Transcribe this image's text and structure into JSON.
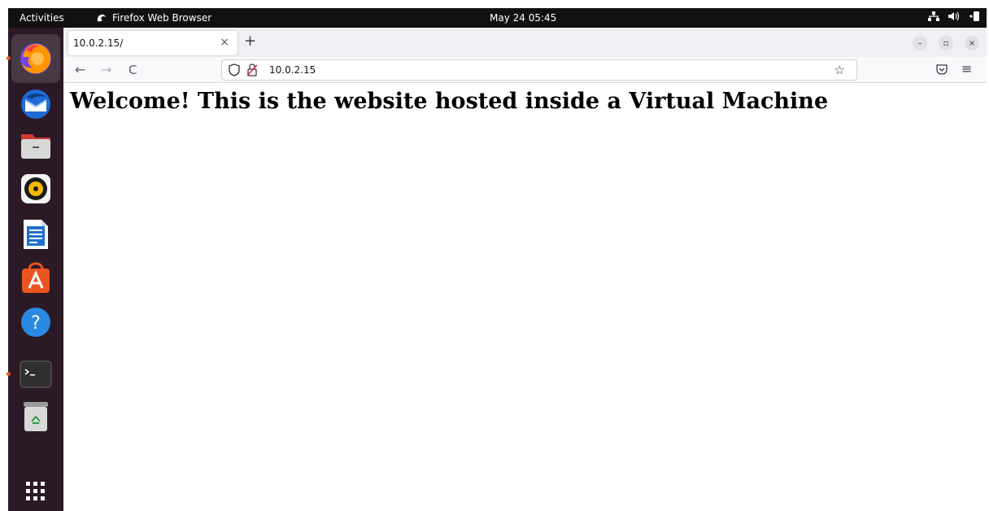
{
  "topbar": {
    "activities": "Activities",
    "app_name": "Firefox Web Browser",
    "clock": "May 24  05:45"
  },
  "dock": {
    "items": [
      "firefox",
      "thunderbird",
      "files",
      "rhythmbox",
      "libreoffice-writer",
      "ubuntu-software",
      "help",
      "terminal",
      "trash",
      "show-applications"
    ]
  },
  "browser": {
    "tab_title": "10.0.2.15/",
    "tab_close": "×",
    "new_tab": "+",
    "back": "←",
    "forward": "→",
    "reload": "C",
    "url": "10.0.2.15",
    "bookmark_star": "☆",
    "menu": "≡",
    "window_minimize": "–",
    "window_restore": "▫",
    "window_close": "×"
  },
  "page": {
    "heading": "Welcome! This is the website hosted inside a Virtual Machine"
  },
  "colors": {
    "topbar": "#111111",
    "dock": "#2b1a26",
    "accent": "#e95420"
  }
}
